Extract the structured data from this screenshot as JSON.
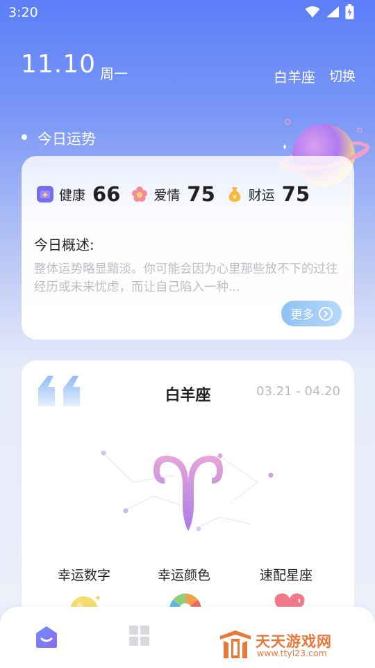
{
  "status_bar": {
    "time": "3:20",
    "icons": [
      "wifi-icon",
      "cellular-signal-icon",
      "battery-charging-icon"
    ]
  },
  "header": {
    "date": "11.10",
    "weekday": "周一",
    "sign": "白羊座",
    "switch_label": "切换"
  },
  "today_fortune": {
    "section_title": "今日运势",
    "scores": [
      {
        "icon": "health-kit-icon",
        "label": "健康",
        "value": "66",
        "color": "#7a6cf0"
      },
      {
        "icon": "flower-icon",
        "label": "爱情",
        "value": "75",
        "color": "#f07a8a"
      },
      {
        "icon": "money-bag-icon",
        "label": "财运",
        "value": "75",
        "color": "#f5b942"
      }
    ],
    "overview_label": "今日概述:",
    "overview_text": "整体运势略显黯淡。你可能会因为心里那些放不下的过往经历或未来忧虑，而让自己陷入一种...",
    "more_label": "更多"
  },
  "zodiac": {
    "name": "白羊座",
    "date_range": "03.21 - 04.20",
    "lucky_items": [
      {
        "label": "幸运数字",
        "icon": "sun-icon"
      },
      {
        "label": "幸运颜色",
        "icon": "color-wheel-icon"
      },
      {
        "label": "速配星座",
        "icon": "heart-icon"
      }
    ]
  },
  "bottom_nav": {
    "items": [
      {
        "icon": "home-icon",
        "active": true
      },
      {
        "icon": "grid-icon",
        "active": false
      }
    ]
  },
  "watermark": {
    "title": "天天游戏网",
    "url": "www.ttyl23.com"
  },
  "colors": {
    "accent": "#5b7ef8",
    "score_text": "#222222",
    "muted_text": "#bdbdc4",
    "more_button": "#9cc9f7",
    "zodiac_symbol": "#c98ee0",
    "watermark": "#e8793a"
  }
}
